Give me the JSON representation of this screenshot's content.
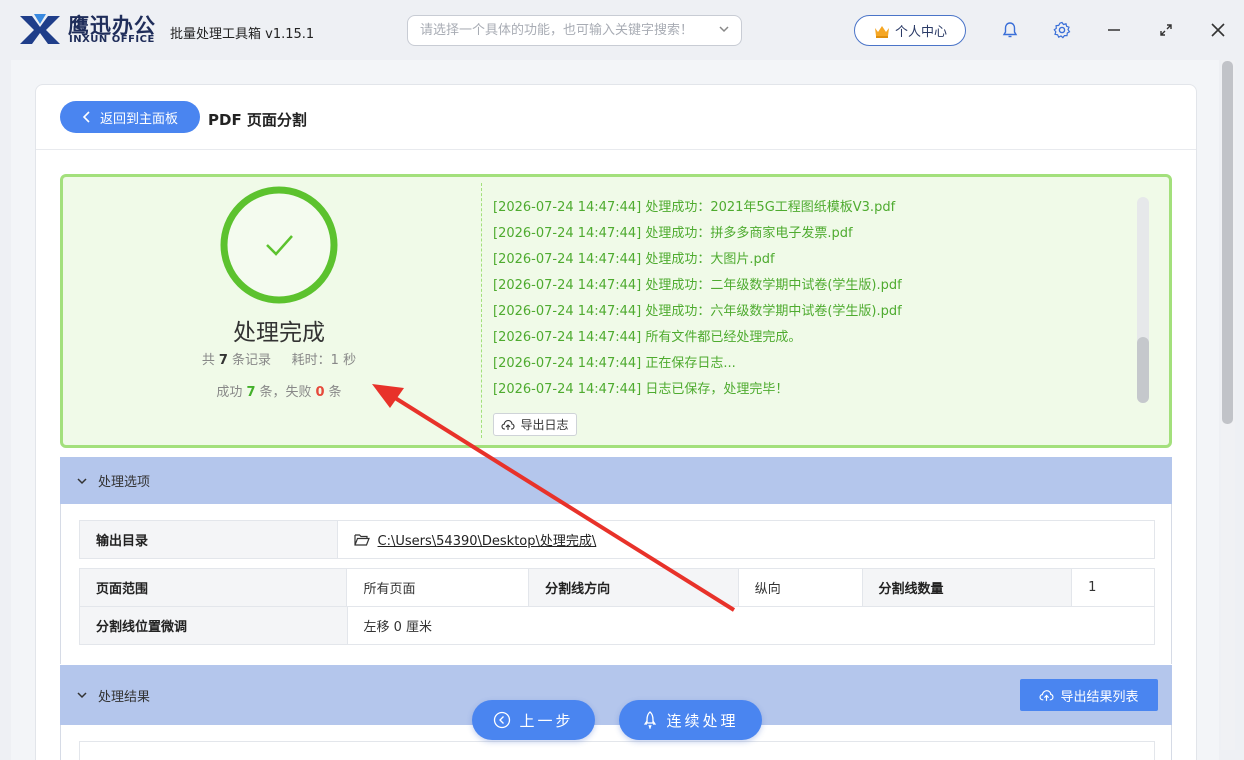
{
  "app": {
    "brand_cn": "鹰迅办公",
    "brand_en": "INXUN OFFICE",
    "title": "批量处理工具箱 v1.15.1",
    "search_placeholder": "请选择一个具体的功能，也可输入关键字搜索！",
    "user_center": "个人中心"
  },
  "page": {
    "back_label": "返回到主面板",
    "title": "PDF 页面分割"
  },
  "result": {
    "status": "处理完成",
    "total_prefix": "共",
    "total_count": "7",
    "total_suffix": "条记录",
    "time_prefix": "耗时：",
    "time_value": "1",
    "time_suffix": "秒",
    "success_prefix": "成功",
    "success_count": "7",
    "success_suffix": "条，失败",
    "fail_count": "0",
    "fail_suffix": "条"
  },
  "log": {
    "lines": [
      "[2026-07-24 14:47:44] 处理成功：2021年5G工程图纸模板V3.pdf",
      "[2026-07-24 14:47:44] 处理成功：拼多多商家电子发票.pdf",
      "[2026-07-24 14:47:44] 处理成功：大图片.pdf",
      "[2026-07-24 14:47:44] 处理成功：二年级数学期中试卷(学生版).pdf",
      "[2026-07-24 14:47:44] 处理成功：六年级数学期中试卷(学生版).pdf",
      "[2026-07-24 14:47:44] 所有文件都已经处理完成。",
      "[2026-07-24 14:47:44] 正在保存日志...",
      "[2026-07-24 14:47:44] 日志已保存，处理完毕！"
    ],
    "export_label": "导出日志"
  },
  "options": {
    "header": "处理选项",
    "output_dir_label": "输出目录",
    "output_dir_value": "C:\\Users\\54390\\Desktop\\处理完成\\",
    "page_range_label": "页面范围",
    "page_range_value": "所有页面",
    "split_direction_label": "分割线方向",
    "split_direction_value": "纵向",
    "split_count_label": "分割线数量",
    "split_count_value": "1",
    "split_adjust_label": "分割线位置微调",
    "split_adjust_value": "左移 0 厘米"
  },
  "results": {
    "header": "处理结果",
    "export_label": "导出结果列表"
  },
  "footer": {
    "prev_label": "上一步",
    "continue_label": "连续处理"
  },
  "colors": {
    "primary": "#4a85f0",
    "success_green": "#43b02a",
    "success_border": "#a3e07c",
    "section_header": "#b4c6ec",
    "fail_red": "#e64a3b"
  }
}
